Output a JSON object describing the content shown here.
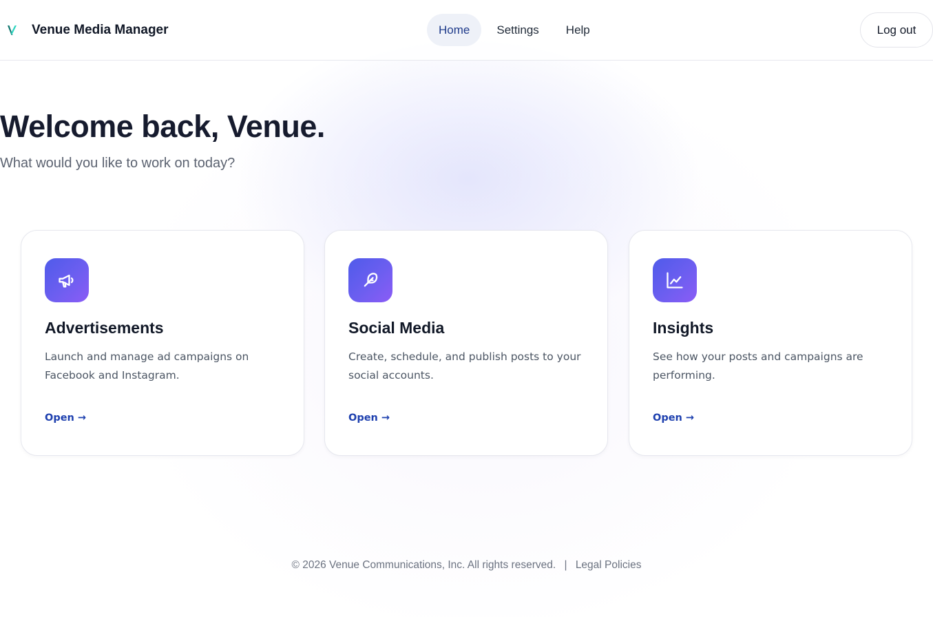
{
  "app": {
    "name": "Venue Media Manager",
    "logo_letter": "V",
    "accent": "#1e40af",
    "gradient_start": "#4f5bea",
    "gradient_end": "#8b5cf6"
  },
  "nav": {
    "items": [
      {
        "label": "Home",
        "active": true
      },
      {
        "label": "Settings",
        "active": false
      },
      {
        "label": "Help",
        "active": false
      }
    ],
    "logout_label": "Log out"
  },
  "hero": {
    "title": "Welcome back, Venue.",
    "subtitle": "What would you like to work on today?"
  },
  "cards": [
    {
      "icon": "megaphone-icon",
      "title": "Advertisements",
      "description": "Launch and manage ad campaigns on Facebook and Instagram.",
      "action": "Open →"
    },
    {
      "icon": "feather-icon",
      "title": "Social Media",
      "description": "Create, schedule, and publish posts to your social accounts.",
      "action": "Open →"
    },
    {
      "icon": "line-chart-icon",
      "title": "Insights",
      "description": "See how your posts and campaigns are performing.",
      "action": "Open →"
    }
  ],
  "footer": {
    "copyright": "© 2026 Venue Communications, Inc. All rights reserved.",
    "separator": "|",
    "legal_link": "Legal Policies"
  }
}
